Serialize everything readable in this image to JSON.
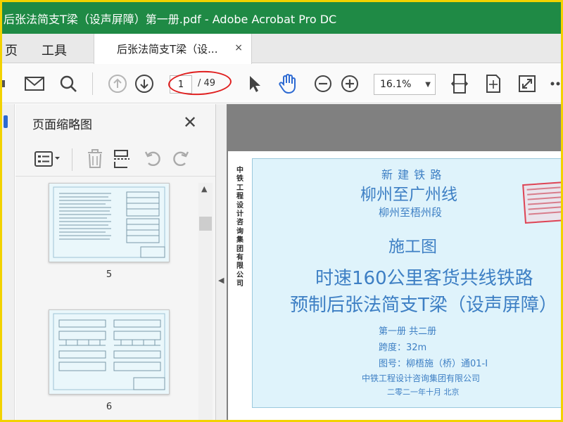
{
  "window": {
    "title": "后张法简支T梁（设声屏障）第一册.pdf - Adobe Acrobat Pro DC"
  },
  "menu": {
    "items": [
      "页",
      "工具"
    ],
    "tab_label": "后张法简支T梁（设...",
    "tab_close": "×"
  },
  "toolbar": {
    "page_current": "1",
    "page_total": "/ 49",
    "zoom": "16.1%"
  },
  "thumbnails": {
    "title": "页面缩略图",
    "close": "✕",
    "pages": [
      {
        "label": "5"
      },
      {
        "label": "6"
      }
    ]
  },
  "document": {
    "side_text": "中铁工程设计咨询集团有限公司",
    "line1": "新 建 铁 路",
    "line2": "柳州至广州线",
    "line3": "柳州至梧州段",
    "line4": "施工图",
    "line5": "时速160公里客货共线铁路",
    "line6": "预制后张法简支T梁（设声屏障）",
    "line7": "第一册  共二册",
    "line8": "跨度：32m",
    "line9": "图号：柳梧施（桥）通01-Ⅰ",
    "line10": "中铁工程设计咨询集团有限公司",
    "line11": "二零二一年十月   北京"
  },
  "colors": {
    "title_bar": "#1f8a45",
    "annotation": "#e02020",
    "doc_text": "#3d7fc4"
  }
}
